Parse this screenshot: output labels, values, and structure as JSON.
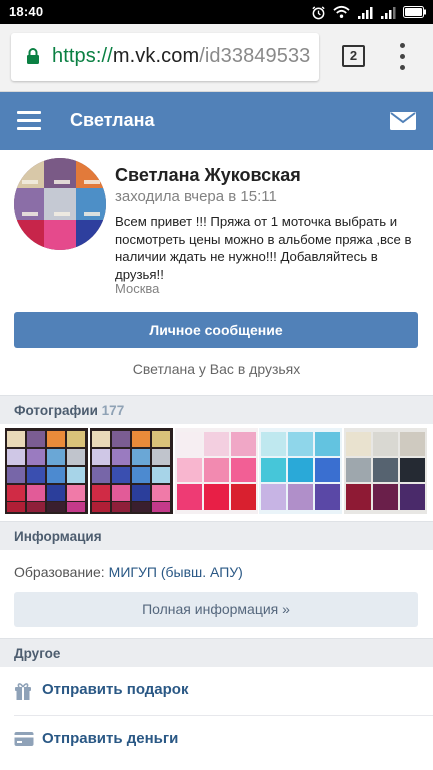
{
  "status_bar": {
    "time": "18:40"
  },
  "browser": {
    "url_scheme": "https://",
    "url_host": "m.vk.com",
    "url_path": "/id33849533",
    "tab_count": "2"
  },
  "header": {
    "title": "Светлана"
  },
  "profile": {
    "name": "Светлана Жуковская",
    "status": "заходила вчера в 15:11",
    "about": "Всем привет !!! Пряжа от 1 моточка выбрать и посмотреть цены можно в альбоме пряжа ,все в наличии ждать не нужно!!! Добавляйтесь в друзья!!",
    "city": "Москва",
    "message_button": "Личное сообщение",
    "friend_note": "Светлана у Вас в друзьях"
  },
  "photos": {
    "label": "Фотографии",
    "count": "177"
  },
  "info": {
    "label": "Информация",
    "education_label": "Образование:",
    "education_value": "МИГУП (бывш. АПУ)",
    "full_info_button": "Полная информация »"
  },
  "other": {
    "label": "Другое",
    "items": [
      {
        "label": "Отправить подарок",
        "icon": "gift-icon"
      },
      {
        "label": "Отправить деньги",
        "icon": "card-icon"
      }
    ]
  },
  "colors": {
    "brand": "#5181b8",
    "link": "#2a5885",
    "section_bg": "#ebedf0",
    "secure": "#0b8043"
  }
}
